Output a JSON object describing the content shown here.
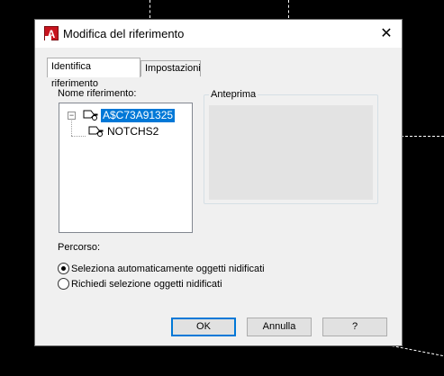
{
  "dialog": {
    "title": "Modifica del riferimento",
    "app_icon_letter": "A",
    "close_glyph": "✕"
  },
  "tabs": [
    {
      "label": "Identifica riferimento",
      "active": true
    },
    {
      "label": "Impostazioni",
      "active": false
    }
  ],
  "reference_name": {
    "label": "Nome riferimento:",
    "tree": {
      "toggle_glyph": "−",
      "root": {
        "label": "A$C73A91325",
        "selected": true
      },
      "children": [
        {
          "label": "NOTCHS2"
        }
      ]
    }
  },
  "preview": {
    "label": "Anteprima"
  },
  "path": {
    "label": "Percorso:",
    "options": [
      {
        "label": "Seleziona automaticamente oggetti nidificati",
        "selected": true
      },
      {
        "label": "Richiedi selezione oggetti nidificati",
        "selected": false
      }
    ]
  },
  "buttons": {
    "ok": "OK",
    "cancel": "Annulla",
    "help": "?"
  },
  "colors": {
    "selection": "#0078d7",
    "app_icon": "#c8141e",
    "dialog_bg": "#f0f0f0",
    "preview_bg": "#e3e3e3"
  }
}
